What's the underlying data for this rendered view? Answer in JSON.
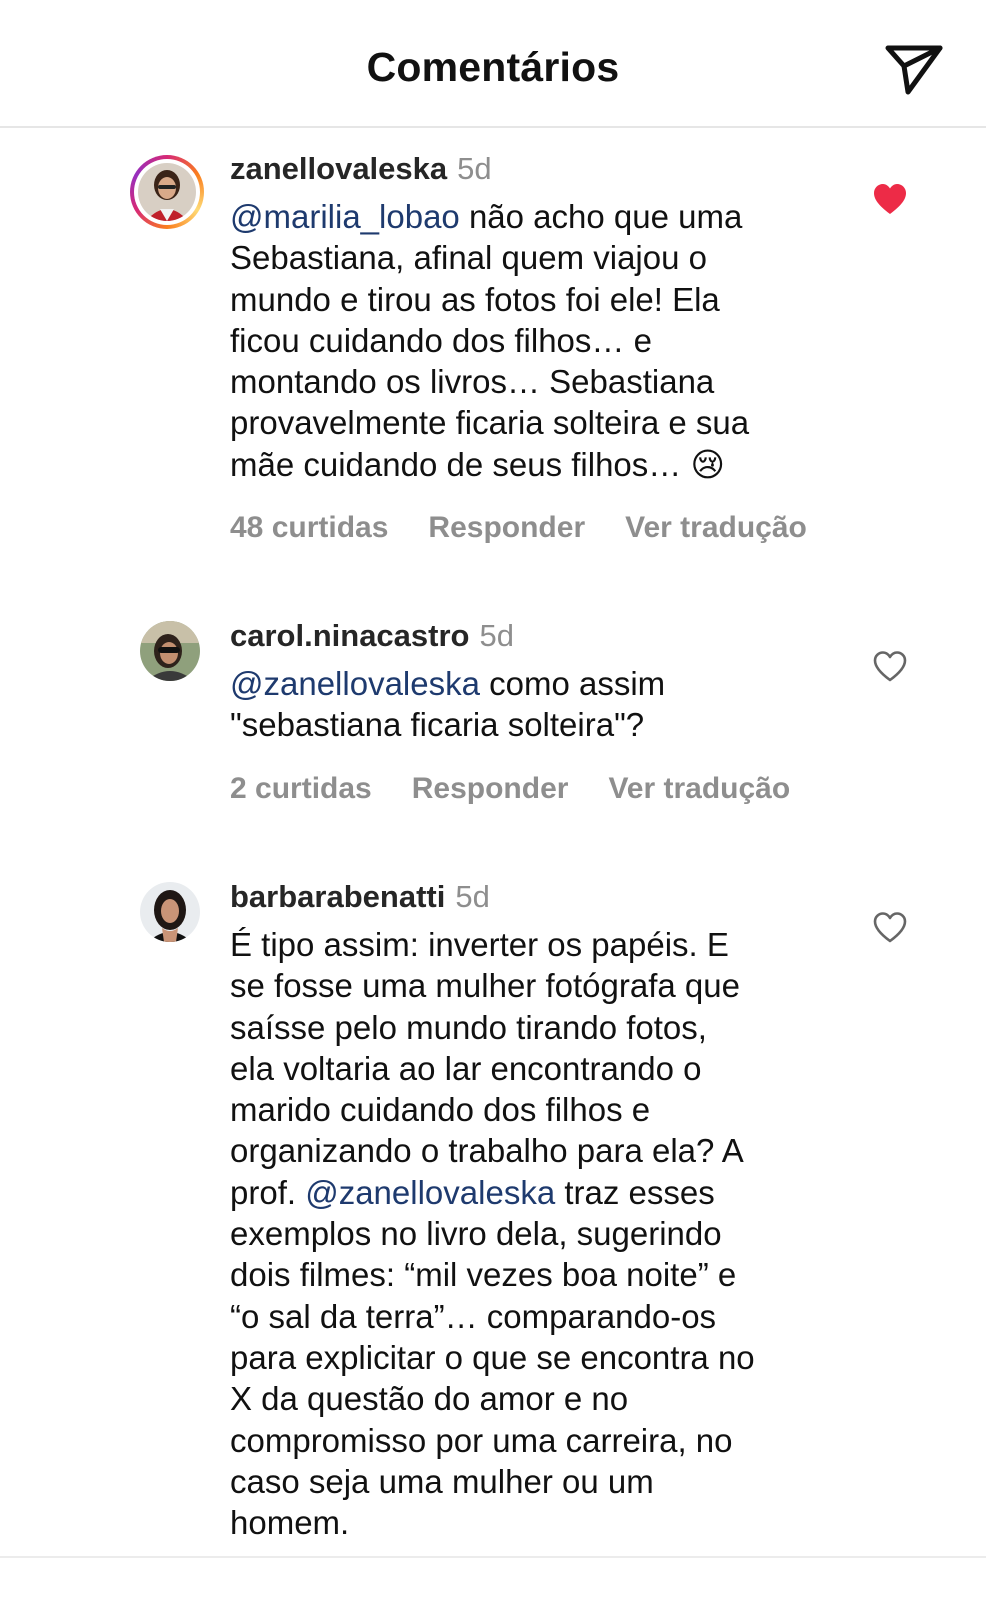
{
  "header": {
    "title": "Comentários"
  },
  "icons": {
    "send": "paper-plane-icon",
    "like_filled": "heart-filled-icon",
    "like_outline": "heart-outline-icon"
  },
  "colors": {
    "mention": "#1e3a6e",
    "like": "#ed2b47",
    "muted": "#8e8e8e"
  },
  "comments": [
    {
      "username": "zanellovaleska",
      "time": "5d",
      "mention": "@marilia_lobao",
      "text_after": " não acho que uma\nSebastiana, afinal quem viajou o\nmundo e tirou as fotos foi ele! Ela\nficou cuidando dos filhos… e\nmontando os livros… Sebastiana\nprovavelmente ficaria solteira e sua\nmãe cuidando de seus filhos… ",
      "emoji": "😢",
      "likes": "48 curtidas",
      "reply": "Responder",
      "translate": "Ver tradução",
      "liked": true
    },
    {
      "username": "carol.ninacastro",
      "time": "5d",
      "mention": "@zanellovaleska",
      "text_after": " como assim\n\"sebastiana ficaria solteira\"?",
      "likes": "2 curtidas",
      "reply": "Responder",
      "translate": "Ver tradução",
      "liked": false
    },
    {
      "username": "barbarabenatti",
      "time": "5d",
      "text_before": "É tipo assim: inverter os papéis. E\nse fosse uma mulher fotógrafa que\nsaísse pelo mundo tirando fotos,\nela voltaria ao lar encontrando o\nmarido cuidando dos filhos e\norganizando o trabalho para ela? A\nprof. ",
      "mention": "@zanellovaleska",
      "text_after": " traz esses\nexemplos no livro dela, sugerindo\ndois filmes: “mil vezes boa noite” e\n“o sal da terra”… comparando-os\npara explicitar o que se encontra no\nX da questão do amor e no\ncompromisso por uma carreira, no\ncaso seja uma mulher ou um\nhomem.",
      "liked": false
    }
  ]
}
